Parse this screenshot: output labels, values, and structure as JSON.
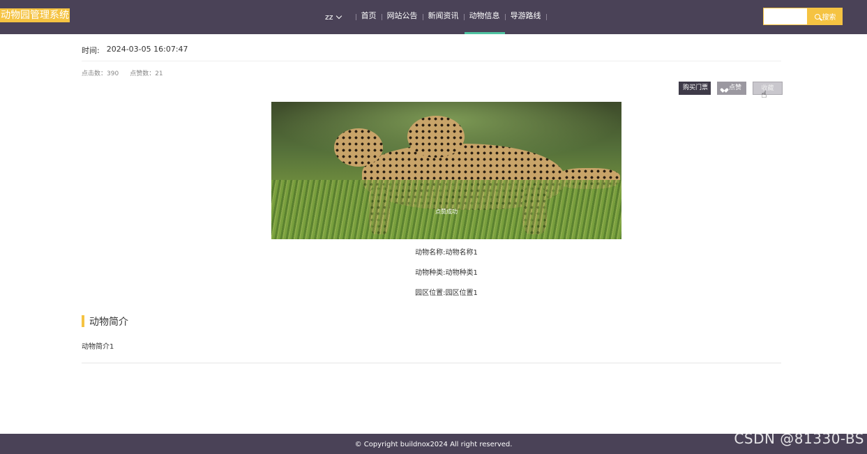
{
  "header": {
    "logo": "动物园管理系统",
    "user": "zz",
    "nav": [
      "首页",
      "网站公告",
      "新闻资讯",
      "动物信息",
      "导游路线"
    ],
    "active_nav": "动物信息",
    "search_placeholder": "",
    "search_button": "搜索"
  },
  "detail": {
    "time_label": "时间:",
    "time_value": "2024-03-05 16:07:47",
    "clicks": "点击数：390",
    "likes": "点赞数：21",
    "buy_button": "购买门票",
    "like_button": "点赞",
    "fav_button": "收藏",
    "toast": "点赞成功",
    "attr_name": "动物名称:动物名称1",
    "attr_type": "动物种类:动物种类1",
    "attr_location": "园区位置:园区位置1",
    "section_title": "动物简介",
    "intro": "动物简介1"
  },
  "footer": {
    "copyright": "© Copyright buildnox2024   All right reserved."
  },
  "watermark": "CSDN @81330-BS",
  "colors": {
    "header_bg": "#4a4257",
    "accent": "#f5c342",
    "active_underline": "#4fc3a1"
  }
}
